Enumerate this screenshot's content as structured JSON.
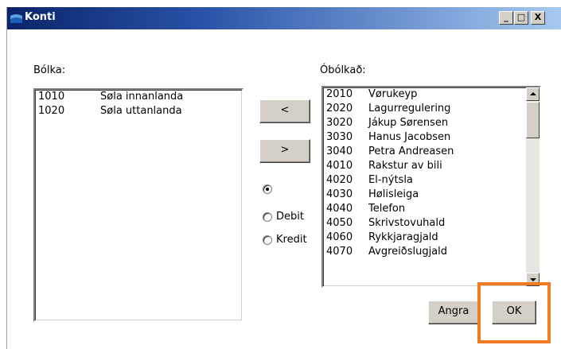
{
  "window": {
    "title": "Konti",
    "minimize_label": "_",
    "maximize_label": "□",
    "close_label": "X"
  },
  "left_panel": {
    "label": "Bólka:",
    "items": [
      {
        "code": "1010",
        "name": "Søla innanlanda"
      },
      {
        "code": "1020",
        "name": "Søla uttanlanda"
      }
    ]
  },
  "right_panel": {
    "label": "Óbólkað:",
    "items": [
      {
        "code": "2010",
        "name": "Vørukeyp"
      },
      {
        "code": "2020",
        "name": "Lagurregulering"
      },
      {
        "code": "3020",
        "name": "Jákup Sørensen"
      },
      {
        "code": "3030",
        "name": "Hanus Jacobsen"
      },
      {
        "code": "3040",
        "name": "Petra Andreasen"
      },
      {
        "code": "4010",
        "name": "Rakstur av bili"
      },
      {
        "code": "4020",
        "name": "El-nýtsla"
      },
      {
        "code": "4030",
        "name": "Hølisleiga"
      },
      {
        "code": "4040",
        "name": "Telefon"
      },
      {
        "code": "4050",
        "name": "Skrivstovuhald"
      },
      {
        "code": "4060",
        "name": "Rykkjaragjald"
      },
      {
        "code": "4070",
        "name": "Avgreiðslugjald"
      }
    ]
  },
  "transfer": {
    "move_left": "<",
    "move_right": ">"
  },
  "radios": [
    {
      "label": "",
      "checked": true
    },
    {
      "label": "Debit",
      "checked": false
    },
    {
      "label": "Kredit",
      "checked": false
    }
  ],
  "buttons": {
    "cancel": "Angra",
    "ok": "OK"
  },
  "colors": {
    "title_bar": "#0a246a",
    "highlight": "#f07b23",
    "button_face": "#d4d0c8"
  }
}
